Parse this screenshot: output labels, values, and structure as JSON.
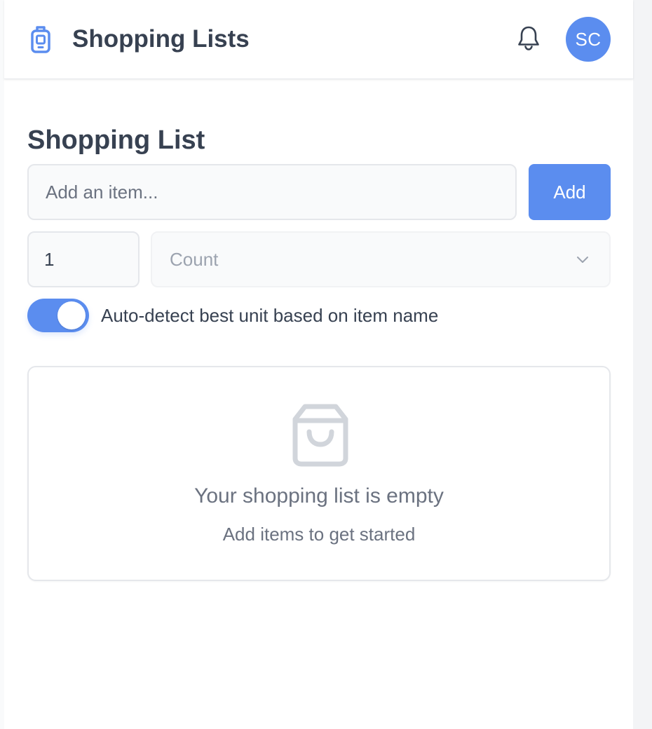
{
  "header": {
    "app_title": "Shopping Lists",
    "user_initials": "SC"
  },
  "main": {
    "title": "Shopping List",
    "item_input": {
      "placeholder": "Add an item...",
      "value": ""
    },
    "add_button_label": "Add",
    "quantity_value": "1",
    "unit_select": {
      "selected": "Count"
    },
    "auto_detect": {
      "label": "Auto-detect best unit based on item name",
      "enabled": true
    },
    "empty_state": {
      "title": "Your shopping list is empty",
      "subtitle": "Add items to get started"
    }
  },
  "icons": [
    "shopping-list-logo-icon",
    "bell-icon",
    "chevron-down-icon",
    "shopping-bag-icon"
  ],
  "colors": {
    "accent": "#5b8def",
    "text": "#374151",
    "muted": "#6b7280",
    "placeholder": "#9ca3af",
    "border": "#e5e7eb",
    "icon_gray": "#d1d5db"
  }
}
